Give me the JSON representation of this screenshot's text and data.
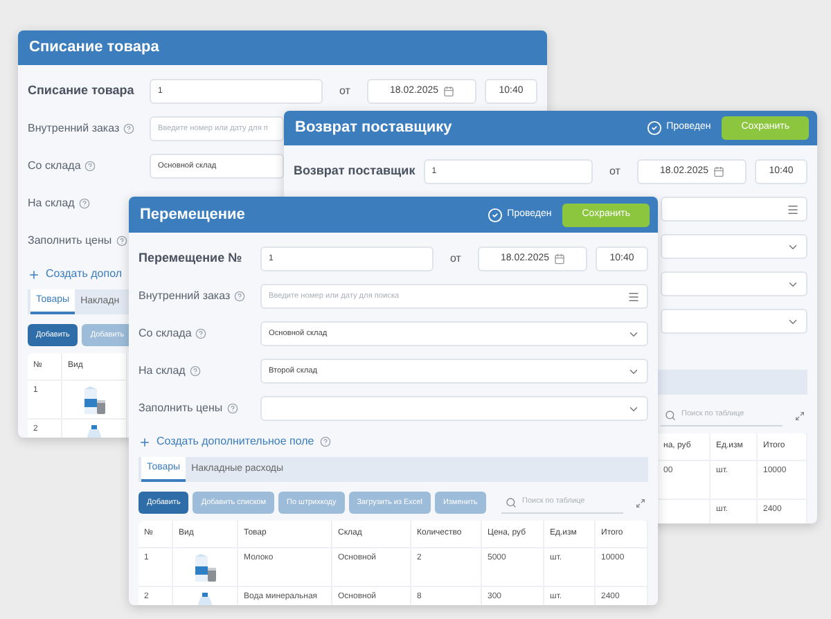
{
  "windows": [
    {
      "title": "Списание товара",
      "number_label": "Списание товара",
      "number": "1",
      "date_prefix": "от",
      "date": "18.02.2025",
      "time": "10:40",
      "fields": [
        {
          "label": "Внутренний заказ",
          "help": true,
          "kind": "text",
          "placeholder": "Введите номер или дату для п"
        },
        {
          "label": "Со склада",
          "help": true,
          "kind": "text",
          "value": "Основной склад"
        },
        {
          "label": "На склад",
          "help": true
        },
        {
          "label": "Заполнить цены",
          "help": true
        }
      ],
      "add_field": "Создать допол",
      "tabs": [
        {
          "label": "Товары",
          "selected": true
        },
        {
          "label": "Накладн",
          "selected": false
        }
      ],
      "buttons": [
        {
          "label": "Добавить",
          "primary": true
        },
        {
          "label": "Добавить",
          "primary": false
        }
      ],
      "table": {
        "columns": [
          "№",
          "Вид"
        ],
        "rows": [
          [
            "1",
            {
              "kind": "picture"
            }
          ],
          [
            "2",
            {
              "kind": "picture"
            }
          ]
        ]
      }
    },
    {
      "title": "Возврат поставщику",
      "status": {
        "label": "Проведен",
        "checked": true
      },
      "save": "Сохранить",
      "number_label": "Возврат поставщик",
      "number": "1",
      "date_prefix": "от",
      "date": "18.02.2025",
      "time": "10:40",
      "fields": [
        {
          "kind": "search"
        },
        {
          "kind": "select"
        },
        {
          "kind": "select"
        },
        {
          "kind": "select"
        }
      ],
      "search": {
        "placeholder": "Поиск по таблице"
      },
      "table": {
        "columns": [
          "на, руб",
          "Ед.изм",
          "Итого"
        ],
        "rows": [
          [
            "00",
            "шт.",
            "10000"
          ],
          [
            null,
            "шт.",
            "2400"
          ]
        ]
      }
    },
    {
      "title": "Перемещение",
      "status": {
        "label": "Проведен",
        "checked": true
      },
      "save": "Сохранить",
      "number_label": "Перемещение №",
      "number": "1",
      "date_prefix": "от",
      "date": "18.02.2025",
      "time": "10:40",
      "fields": [
        {
          "label": "Внутренний заказ",
          "help": true,
          "kind": "search",
          "placeholder": "Введите номер или дату для поиска"
        },
        {
          "label": "Со склада",
          "help": true,
          "kind": "select",
          "value": "Основной склад"
        },
        {
          "label": "На склад",
          "help": true,
          "kind": "select",
          "value": "Второй склад"
        },
        {
          "label": "Заполнить цены",
          "help": true,
          "kind": "select"
        }
      ],
      "add_field": "Создать дополнительное поле",
      "add_field_help": true,
      "tabs": [
        {
          "label": "Товары",
          "selected": true
        },
        {
          "label": "Накладные расходы",
          "selected": false
        }
      ],
      "buttons": [
        {
          "label": "Добавить",
          "primary": true
        },
        {
          "label": "Добавить списком",
          "primary": false
        },
        {
          "label": "По штрихкоду",
          "primary": false
        },
        {
          "label": "Загрузить из Excel",
          "primary": false
        },
        {
          "label": "Изменить",
          "primary": false
        }
      ],
      "search": {
        "placeholder": "Поиск по таблице"
      },
      "table": {
        "columns": [
          "№",
          "Вид",
          "Товар",
          "Склад",
          "Количество",
          "Цена, руб",
          "Ед.изм",
          "Итого"
        ],
        "rows": [
          [
            "1",
            {
              "kind": "picture"
            },
            "Молоко",
            "Основной",
            "2",
            "5000",
            "шт.",
            "10000"
          ],
          [
            "2",
            {
              "kind": "picture"
            },
            "Вода минеральная",
            "Основной",
            "8",
            "300",
            "шт.",
            "2400"
          ]
        ]
      }
    }
  ]
}
